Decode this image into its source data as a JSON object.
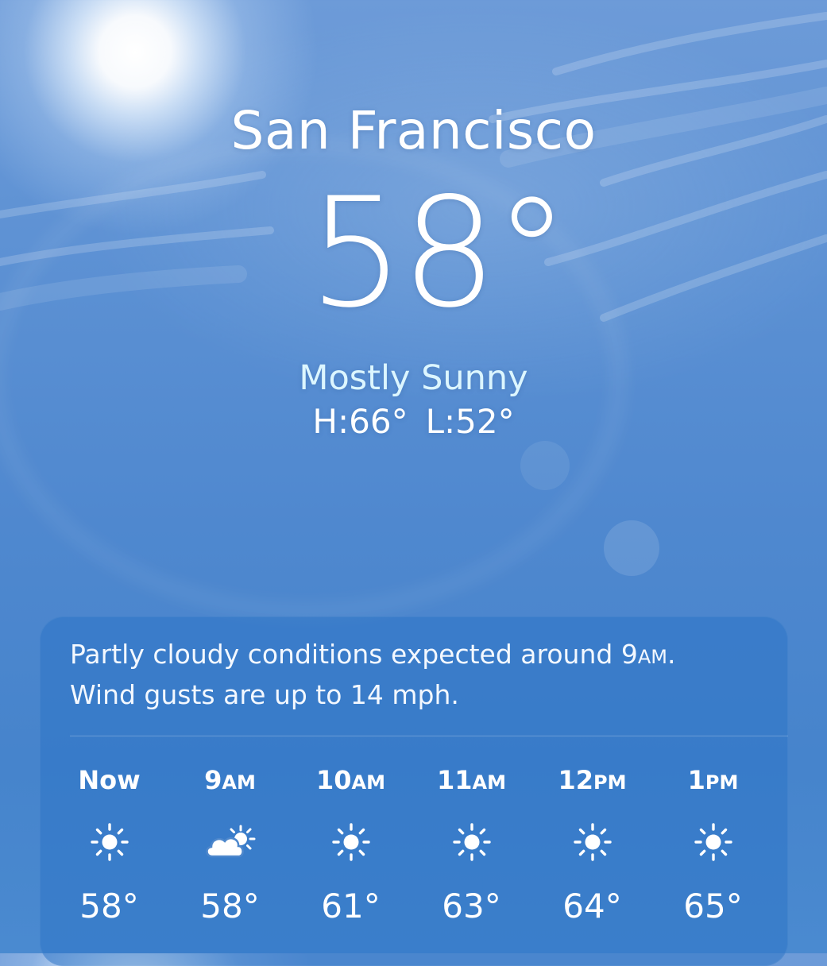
{
  "location": {
    "city": "San Francisco",
    "current_temp": "58°",
    "condition": "Mostly Sunny",
    "high": "H:66°",
    "low": "L:52°"
  },
  "forecast_card": {
    "summary_line1": "Partly cloudy conditions expected around 9AM.",
    "summary_line2": "Wind gusts are up to 14 mph.",
    "hours": [
      {
        "time": "Now",
        "icon": "sun-icon",
        "temp": "58°"
      },
      {
        "time": "9AM",
        "icon": "partly-cloudy-icon",
        "temp": "58°"
      },
      {
        "time": "10AM",
        "icon": "sun-icon",
        "temp": "61°"
      },
      {
        "time": "11AM",
        "icon": "sun-icon",
        "temp": "63°"
      },
      {
        "time": "12PM",
        "icon": "sun-icon",
        "temp": "64°"
      },
      {
        "time": "1PM",
        "icon": "sun-icon",
        "temp": "65°"
      }
    ]
  },
  "colors": {
    "sky_top": "#6d9bd8",
    "sky_bottom": "#4a8ad0",
    "condition_text": "#dcf6ff",
    "card_background": "#2e74c6"
  }
}
